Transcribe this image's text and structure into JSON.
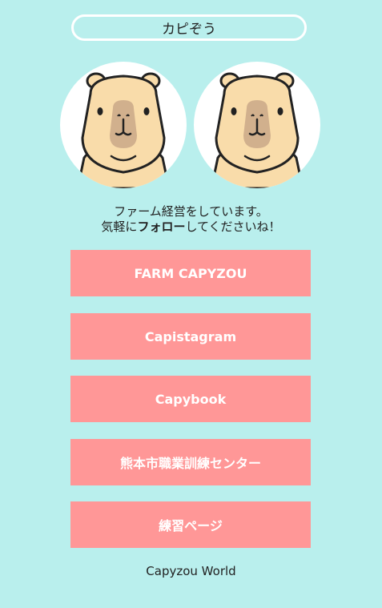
{
  "header": {
    "title": "カピぞう"
  },
  "bio": {
    "line1": "ファーム経営をしています。",
    "line2_prefix": "気軽に",
    "line2_bold": "フォロー",
    "line2_suffix": "してくださいね！"
  },
  "links": [
    {
      "label": "FARM CAPYZOU"
    },
    {
      "label": "Capistagram"
    },
    {
      "label": "Capybook"
    },
    {
      "label": "熊本市職業訓練センター"
    },
    {
      "label": "練習ページ"
    }
  ],
  "footer": {
    "text": "Capyzou World"
  },
  "avatars": [
    {
      "icon": "capybara-icon"
    },
    {
      "icon": "capybara-icon"
    }
  ],
  "colors": {
    "background": "#b9efed",
    "button": "#ff9797",
    "button_text": "#ffffff",
    "capybara_fur": "#f9dcaa",
    "capybara_nose": "#d1b08d"
  }
}
